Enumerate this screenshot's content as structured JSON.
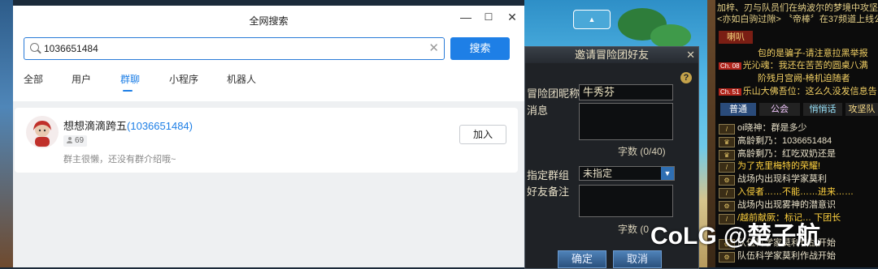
{
  "window": {
    "title": "全网搜索",
    "controls": {
      "minimize": "—",
      "maximize": "☐",
      "close": "✕"
    }
  },
  "search": {
    "value": "1036651484",
    "placeholder": "",
    "button_label": "搜索"
  },
  "tabs": [
    {
      "label": "全部",
      "active": false
    },
    {
      "label": "用户",
      "active": false
    },
    {
      "label": "群聊",
      "active": true
    },
    {
      "label": "小程序",
      "active": false
    },
    {
      "label": "机器人",
      "active": false
    }
  ],
  "result": {
    "name": "想想滴滴跨五",
    "id_open": "(",
    "id": "1036651484",
    "id_close": ")",
    "member_count": "69",
    "description": "群主很懒，还没有群介绍哦~",
    "join_label": "加入"
  },
  "invite_dialog": {
    "title": "邀请冒险团好友",
    "nickname_label": "冒险团昵称",
    "nickname_value": "牛秀芬",
    "message_label": "消息",
    "count_label": "字数 (0/40)",
    "group_label": "指定群组",
    "group_value": "未指定",
    "note_label": "好友备注",
    "count2_label": "字数 (0",
    "confirm_label": "确定",
    "cancel_label": "取消"
  },
  "chat": {
    "top_lines": [
      "加梓、刃与队员们在纳波尔的梦境中攻坚后",
      "<亦如白驹过隙> 〝帝棒〞在37频道上线公"
    ],
    "horn_tab": "喇叭",
    "horn_lines": [
      "包的是骗子-请注意拉黑举报",
      "光沁魂：我还在苦苦的圆桌八满",
      "阶残月宫阙-椅机迫随者",
      "乐山大佛吾位：这么久没发信息告"
    ],
    "horn_tags": [
      "Ch. 08",
      "Ch. 51"
    ],
    "tabs": [
      "普通",
      "公会",
      "悄悄话",
      "攻坚队"
    ],
    "messages": [
      "oi晓神：群是多少",
      "高龄剩乃：1036651484",
      "高龄剩乃：红吃双奶还是",
      "为了克里梅特的荣耀!",
      "战场内出现科学家莫利",
      "入侵者……不能……进来……",
      "战场内出现雾神的潜意识",
      "/越前献厥：标记… 下团长",
      "队伍科学家莫利作战开始",
      "队伍科学家莫利作战开始"
    ]
  },
  "watermark": "CoLG @楚子航",
  "colors": {
    "accent": "#1e7fe6",
    "game_gold": "#e6d188",
    "game_panel": "#1f2226"
  }
}
